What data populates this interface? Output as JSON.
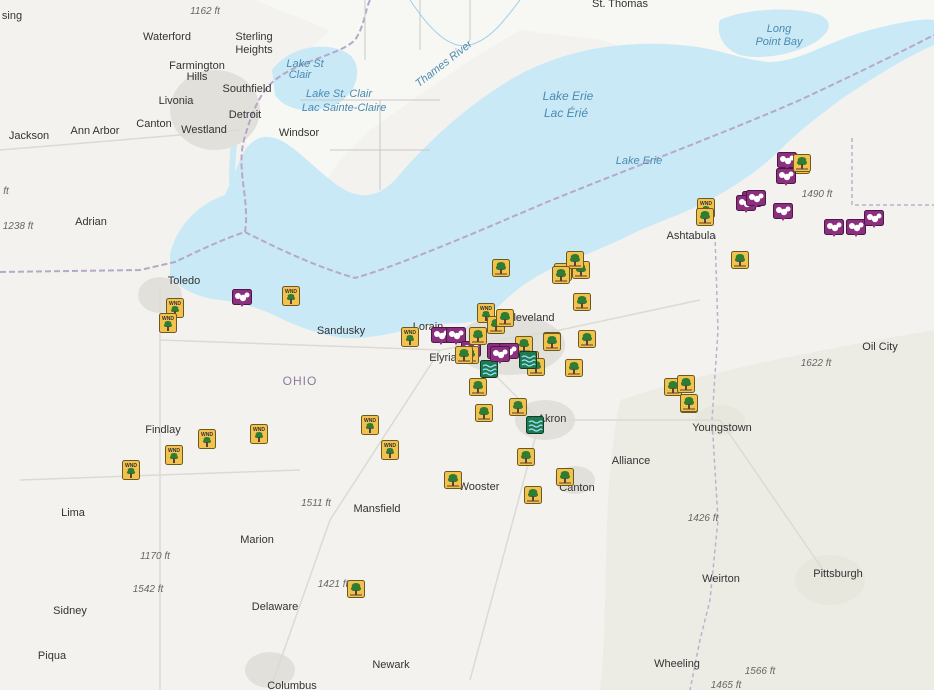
{
  "map": {
    "colors": {
      "land": "#f3f2ee",
      "water": "#c9e9f7",
      "urban": "#e2e0da",
      "border": "#b8a8c8",
      "marker_tree_bg": "#f2c14e",
      "marker_tree_border": "#6b5a1e",
      "marker_hail_bg": "#8b2f7e",
      "marker_flood_bg": "#1f7a4f"
    },
    "labels": [
      {
        "id": "sing",
        "text": "sing",
        "kind": "city"
      },
      {
        "id": "1162",
        "text": "1162 ft",
        "kind": "elev"
      },
      {
        "id": "waterford",
        "text": "Waterford",
        "kind": "city"
      },
      {
        "id": "sterling",
        "text": "Sterling",
        "kind": "city"
      },
      {
        "id": "heights",
        "text": "Heights",
        "kind": "city"
      },
      {
        "id": "farmington",
        "text": "Farmington",
        "kind": "city"
      },
      {
        "id": "hills",
        "text": "Hills",
        "kind": "city"
      },
      {
        "id": "southfield",
        "text": "Southfield",
        "kind": "city"
      },
      {
        "id": "livonia",
        "text": "Livonia",
        "kind": "city"
      },
      {
        "id": "detroit",
        "text": "Detroit",
        "kind": "city"
      },
      {
        "id": "canton_mi",
        "text": "Canton",
        "kind": "city"
      },
      {
        "id": "westland",
        "text": "Westland",
        "kind": "city"
      },
      {
        "id": "windsor",
        "text": "Windsor",
        "kind": "city"
      },
      {
        "id": "jackson",
        "text": "Jackson",
        "kind": "city"
      },
      {
        "id": "annarbor",
        "text": "Ann Arbor",
        "kind": "city"
      },
      {
        "id": "ft_left",
        "text": "ft",
        "kind": "elev"
      },
      {
        "id": "1238",
        "text": "1238 ft",
        "kind": "elev"
      },
      {
        "id": "adrian",
        "text": "Adrian",
        "kind": "city"
      },
      {
        "id": "toledo",
        "text": "Toledo",
        "kind": "city"
      },
      {
        "id": "sandusky",
        "text": "Sandusky",
        "kind": "city"
      },
      {
        "id": "lorain",
        "text": "Lorain",
        "kind": "city"
      },
      {
        "id": "elyria",
        "text": "Elyria",
        "kind": "city"
      },
      {
        "id": "cleveland",
        "text": "Cleveland",
        "kind": "city"
      },
      {
        "id": "ohio",
        "text": "OHIO",
        "kind": "state"
      },
      {
        "id": "findlay",
        "text": "Findlay",
        "kind": "city"
      },
      {
        "id": "akron",
        "text": "Akron",
        "kind": "city"
      },
      {
        "id": "youngstown",
        "text": "Youngstown",
        "kind": "city"
      },
      {
        "id": "alliance",
        "text": "Alliance",
        "kind": "city"
      },
      {
        "id": "wooster",
        "text": "Wooster",
        "kind": "city"
      },
      {
        "id": "canton_oh",
        "text": "Canton",
        "kind": "city"
      },
      {
        "id": "1511",
        "text": "1511 ft",
        "kind": "elev"
      },
      {
        "id": "mansfield",
        "text": "Mansfield",
        "kind": "city"
      },
      {
        "id": "lima",
        "text": "Lima",
        "kind": "city"
      },
      {
        "id": "marion",
        "text": "Marion",
        "kind": "city"
      },
      {
        "id": "1170",
        "text": "1170 ft",
        "kind": "elev"
      },
      {
        "id": "1542",
        "text": "1542 ft",
        "kind": "elev"
      },
      {
        "id": "sidney",
        "text": "Sidney",
        "kind": "city"
      },
      {
        "id": "1421",
        "text": "1421 ft",
        "kind": "elev"
      },
      {
        "id": "delaware",
        "text": "Delaware",
        "kind": "city"
      },
      {
        "id": "piqua",
        "text": "Piqua",
        "kind": "city"
      },
      {
        "id": "newark",
        "text": "Newark",
        "kind": "city"
      },
      {
        "id": "columbus",
        "text": "Columbus",
        "kind": "city"
      },
      {
        "id": "ashtabula",
        "text": "Ashtabula",
        "kind": "city"
      },
      {
        "id": "1490",
        "text": "1490 ft",
        "kind": "elev"
      },
      {
        "id": "1622",
        "text": "1622 ft",
        "kind": "elev"
      },
      {
        "id": "oilcity",
        "text": "Oil City",
        "kind": "city"
      },
      {
        "id": "1426",
        "text": "1426 ft",
        "kind": "elev"
      },
      {
        "id": "weirton",
        "text": "Weirton",
        "kind": "city"
      },
      {
        "id": "pittsburgh",
        "text": "Pittsburgh",
        "kind": "city"
      },
      {
        "id": "wheeling",
        "text": "Wheeling",
        "kind": "city"
      },
      {
        "id": "1566",
        "text": "1566 ft",
        "kind": "elev"
      },
      {
        "id": "1465",
        "text": "1465 ft",
        "kind": "elev"
      },
      {
        "id": "stthomas",
        "text": "St. Thomas",
        "kind": "city"
      },
      {
        "id": "lakestclair1",
        "text": "Lake St",
        "kind": "water"
      },
      {
        "id": "lakestclair2",
        "text": "Clair",
        "kind": "water"
      },
      {
        "id": "lakestclair3",
        "text": "Lake St. Clair",
        "kind": "water"
      },
      {
        "id": "lakestclair4",
        "text": "Lac Sainte-Claire",
        "kind": "water"
      },
      {
        "id": "thames",
        "text": "Thames River",
        "kind": "water"
      },
      {
        "id": "lakeerie1",
        "text": "Lake Erie",
        "kind": "water"
      },
      {
        "id": "lakeerie2",
        "text": "Lac Érié",
        "kind": "water"
      },
      {
        "id": "lakeerie3",
        "text": "Lake Erie",
        "kind": "water"
      },
      {
        "id": "longpoint1",
        "text": "Long",
        "kind": "water"
      },
      {
        "id": "longpoint2",
        "text": "Point Bay",
        "kind": "water"
      }
    ],
    "marker_badge": "WND",
    "markers": [
      {
        "type": "hail"
      },
      {
        "type": "tree-wind"
      },
      {
        "type": "tree-wind"
      },
      {
        "type": "tree-wind"
      },
      {
        "type": "tree-wind"
      },
      {
        "type": "tree-wind"
      },
      {
        "type": "tree-wind"
      },
      {
        "type": "tree-wind"
      },
      {
        "type": "tree-wind"
      },
      {
        "type": "tree-wind"
      },
      {
        "type": "tree-wind"
      },
      {
        "type": "hail"
      },
      {
        "type": "hail"
      },
      {
        "type": "hail"
      },
      {
        "type": "tree"
      },
      {
        "type": "tree"
      },
      {
        "type": "tree-wind"
      },
      {
        "type": "tree"
      },
      {
        "type": "tree"
      },
      {
        "type": "tree"
      },
      {
        "type": "tree"
      },
      {
        "type": "tree"
      },
      {
        "type": "tree"
      },
      {
        "type": "hail"
      },
      {
        "type": "hail"
      },
      {
        "type": "flood"
      },
      {
        "type": "tree"
      },
      {
        "type": "tree"
      },
      {
        "type": "tree"
      },
      {
        "type": "tree"
      },
      {
        "type": "tree"
      },
      {
        "type": "tree"
      },
      {
        "type": "tree"
      },
      {
        "type": "tree"
      },
      {
        "type": "tree"
      },
      {
        "type": "tree"
      },
      {
        "type": "tree"
      },
      {
        "type": "tree"
      },
      {
        "type": "tree"
      },
      {
        "type": "tree"
      },
      {
        "type": "tree"
      },
      {
        "type": "flood"
      },
      {
        "type": "tree"
      },
      {
        "type": "tree"
      },
      {
        "type": "tree"
      },
      {
        "type": "tree"
      },
      {
        "type": "tree-wind"
      },
      {
        "type": "tree"
      },
      {
        "type": "tree"
      },
      {
        "type": "tree"
      },
      {
        "type": "hail"
      },
      {
        "type": "hail"
      },
      {
        "type": "hail"
      },
      {
        "type": "hail"
      },
      {
        "type": "hail"
      },
      {
        "type": "tree"
      },
      {
        "type": "hail"
      },
      {
        "type": "hail"
      },
      {
        "type": "hail"
      },
      {
        "type": "hail"
      },
      {
        "type": "tree"
      },
      {
        "type": "flood"
      },
      {
        "type": "hail"
      },
      {
        "type": "tree"
      },
      {
        "type": "tree"
      }
    ]
  }
}
